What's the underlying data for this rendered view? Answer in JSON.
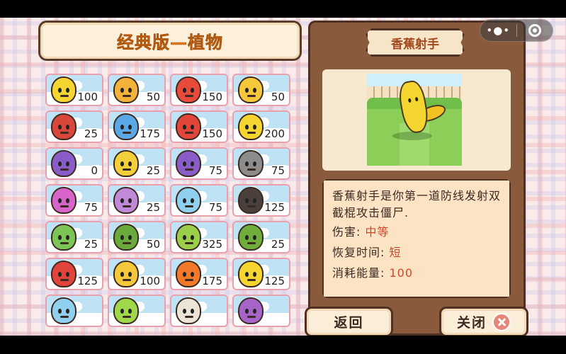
{
  "screen": {
    "title": "经典版—植物"
  },
  "capsule": {
    "more_icon": "more-dots-icon",
    "close_icon": "target-circle-icon"
  },
  "plants": [
    {
      "cost": "100",
      "color": "#f5d630"
    },
    {
      "cost": "50",
      "color": "#f3b33a"
    },
    {
      "cost": "150",
      "color": "#e84b3c"
    },
    {
      "cost": "50",
      "color": "#f5c73a"
    },
    {
      "cost": "25",
      "color": "#d9473a"
    },
    {
      "cost": "175",
      "color": "#5aa8e6"
    },
    {
      "cost": "150",
      "color": "#e2453a"
    },
    {
      "cost": "200",
      "color": "#f5d630"
    },
    {
      "cost": "0",
      "color": "#8a5cc8"
    },
    {
      "cost": "25",
      "color": "#f3cf3a"
    },
    {
      "cost": "75",
      "color": "#8a5cc8"
    },
    {
      "cost": "75",
      "color": "#8c8c8c"
    },
    {
      "cost": "75",
      "color": "#d764c8"
    },
    {
      "cost": "25",
      "color": "#c08ad8"
    },
    {
      "cost": "75",
      "color": "#8fd0ef"
    },
    {
      "cost": "125",
      "color": "#4a3f3a"
    },
    {
      "cost": "25",
      "color": "#7cc456"
    },
    {
      "cost": "50",
      "color": "#6aaa3c"
    },
    {
      "cost": "325",
      "color": "#9bcf4a"
    },
    {
      "cost": "25",
      "color": "#6fae3a"
    },
    {
      "cost": "125",
      "color": "#e0443a"
    },
    {
      "cost": "100",
      "color": "#f5c73a"
    },
    {
      "cost": "175",
      "color": "#f2782a"
    },
    {
      "cost": "125",
      "color": "#f5d630"
    },
    {
      "cost": "",
      "color": "#8fd0ef"
    },
    {
      "cost": "",
      "color": "#9fd84a"
    },
    {
      "cost": "",
      "color": "#ece4d6"
    },
    {
      "cost": "",
      "color": "#a764c8"
    }
  ],
  "detail": {
    "name": "香蕉射手",
    "description": "香蕉射手是你第一道防线发射双截棍攻击僵尸.",
    "stats": [
      {
        "label": "伤害:",
        "value": "中等"
      },
      {
        "label": "恢复时间:",
        "value": "短"
      },
      {
        "label": "消耗能量:",
        "value": "100"
      }
    ]
  },
  "buttons": {
    "back": "返回",
    "close": "关闭"
  }
}
